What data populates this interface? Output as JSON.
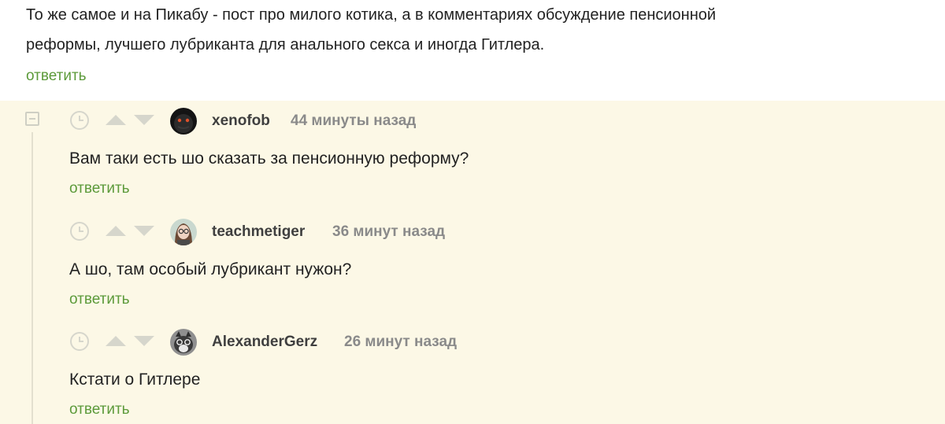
{
  "top_comment": {
    "lines": [
      "То же самое и на Пикабу - пост про милого котика, а в комментариях обсуждение пенсионной",
      "реформы, лучшего лубриканта для анального секса и иногда Гитлера."
    ],
    "reply_label": "ответить"
  },
  "colors": {
    "thread_bg": "#fcf8e6",
    "reply_link": "#5c9a3a",
    "username": "#3f3f3f",
    "time": "#8a8a8a"
  },
  "comments": [
    {
      "username": "xenofob",
      "time": "44 минуты назад",
      "text": "Вам таки есть шо сказать за пенсионную реформу?",
      "reply_label": "ответить",
      "avatar": "dark-figure-avatar"
    },
    {
      "username": "teachmetiger",
      "time": "36 минут назад",
      "text": "А шо, там особый лубрикант нужон?",
      "reply_label": "ответить",
      "avatar": "girl-glasses-avatar"
    },
    {
      "username": "AlexanderGerz",
      "time": "26 минут назад",
      "text": "Кстати о Гитлере",
      "reply_label": "ответить",
      "avatar": "cat-glasses-avatar"
    }
  ]
}
